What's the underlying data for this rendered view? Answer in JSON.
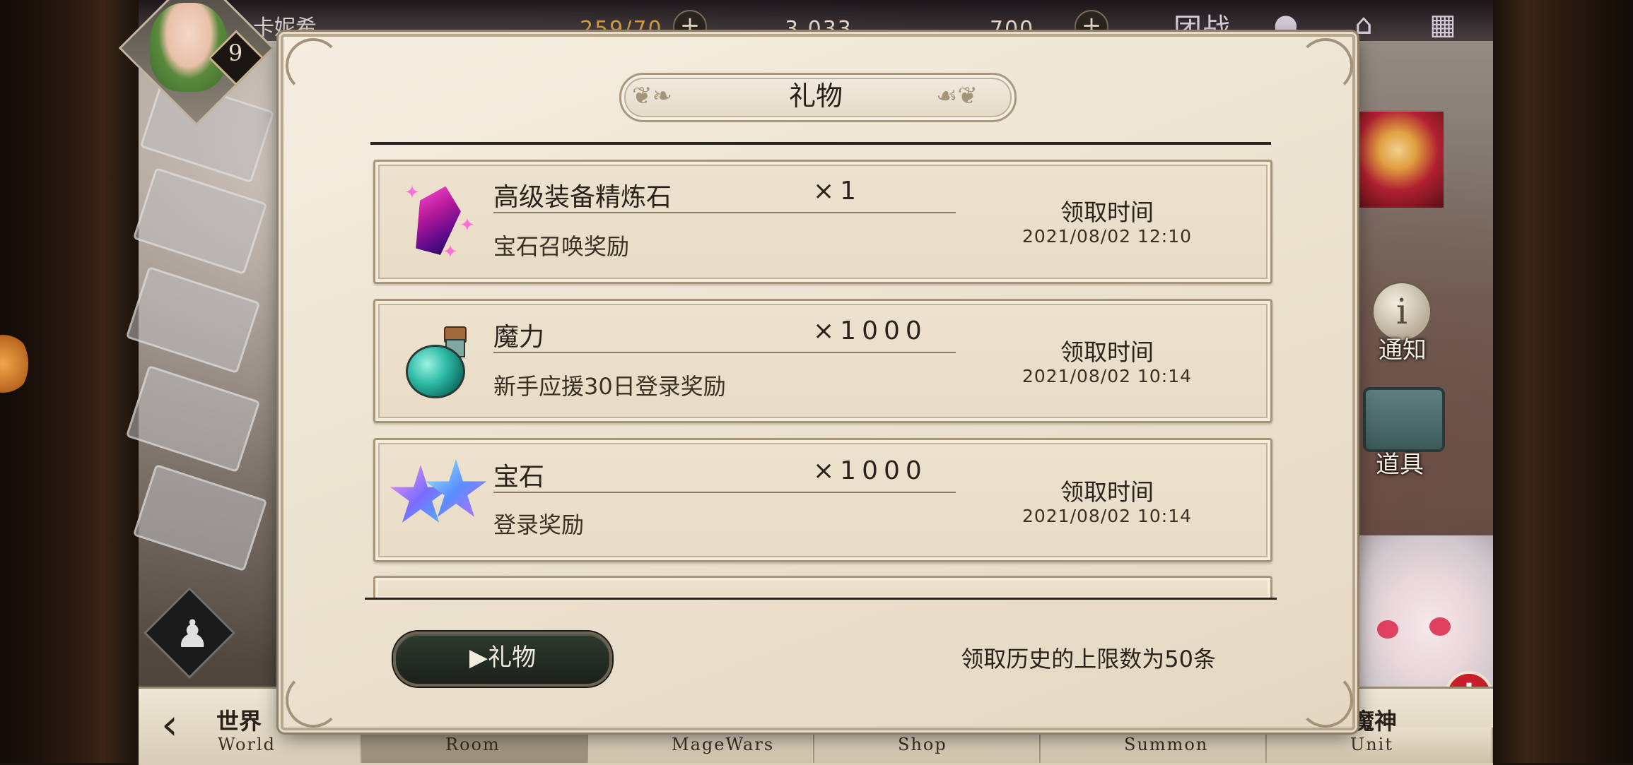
{
  "hud": {
    "player_name": "卡妮希",
    "level": "9",
    "stamina": "259/70",
    "potion": "3,033",
    "gems": "700",
    "team_battle": "团战"
  },
  "side": {
    "notice": "通知",
    "items": "道具"
  },
  "nav": {
    "back_icon": "chevron-left-icon",
    "tabs": [
      {
        "cn": "世界",
        "en": "World"
      },
      {
        "cn": "",
        "en": "Room"
      },
      {
        "cn": "",
        "en": "MageWars"
      },
      {
        "cn": "",
        "en": "Shop"
      },
      {
        "cn": "",
        "en": "Summon"
      },
      {
        "cn": "魔神",
        "en": "Unit"
      }
    ]
  },
  "modal": {
    "title": "礼物",
    "history": [
      {
        "name": "高级装备精炼石",
        "qty": "×1",
        "source": "宝石召唤奖励",
        "claim_label": "领取时间",
        "claim_time": "2021/08/02 12:10",
        "icon": "refine-crystal-icon"
      },
      {
        "name": "魔力",
        "qty": "×1000",
        "source": "新手应援30日登录奖励",
        "claim_label": "领取时间",
        "claim_time": "2021/08/02 10:14",
        "icon": "mana-potion-icon"
      },
      {
        "name": "宝石",
        "qty": "×1000",
        "source": "登录奖励",
        "claim_label": "领取时间",
        "claim_time": "2021/08/02 10:14",
        "icon": "gem-stars-icon"
      }
    ],
    "gift_button": "▶礼物",
    "limit_note": "领取历史的上限数为50条"
  },
  "colors": {
    "modal_bg": "#ece2d0",
    "card_bg": "#e8dcc6",
    "button_bg": "#1a211a",
    "alert": "#c81e2a"
  }
}
